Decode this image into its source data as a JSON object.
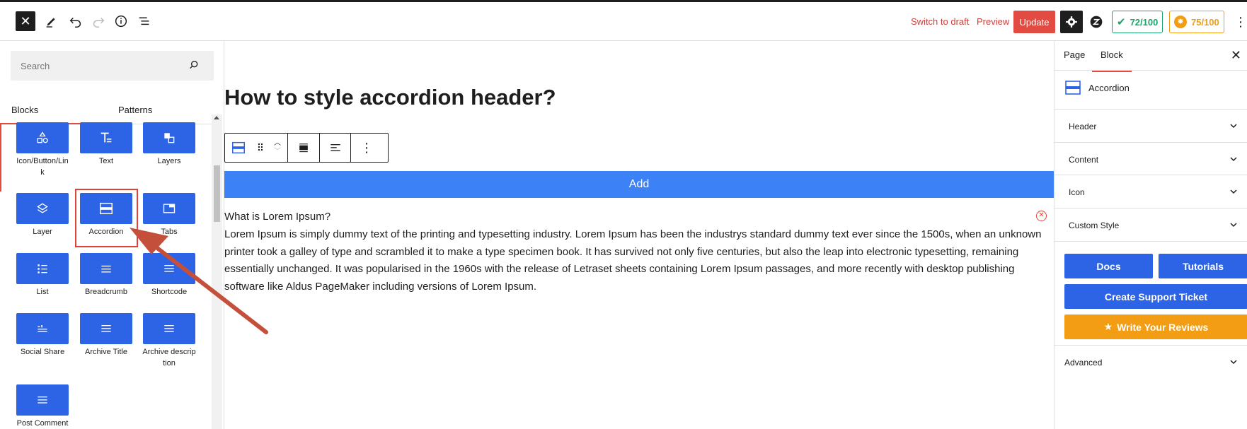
{
  "topbar": {
    "close_icon": "close-icon",
    "switch_to_draft": "Switch to draft",
    "preview": "Preview",
    "update": "Update",
    "score_1": "72/100",
    "score_2": "75/100"
  },
  "left": {
    "search_placeholder": "Search",
    "tab_blocks": "Blocks",
    "tab_patterns": "Patterns",
    "blocks": [
      {
        "label": "Icon/Button/Link",
        "icon": "shapes-icon"
      },
      {
        "label": "Text",
        "icon": "text-icon"
      },
      {
        "label": "Layers",
        "icon": "layers-icon"
      },
      {
        "label": "Layer",
        "icon": "layer-icon"
      },
      {
        "label": "Accordion",
        "icon": "accordion-icon"
      },
      {
        "label": "Tabs",
        "icon": "tabs-icon"
      },
      {
        "label": "List",
        "icon": "list-icon"
      },
      {
        "label": "Breadcrumb",
        "icon": "breadcrumb-icon"
      },
      {
        "label": "Shortcode",
        "icon": "shortcode-icon"
      },
      {
        "label": "Social Share",
        "icon": "social-share-icon"
      },
      {
        "label": "Archive Title",
        "icon": "archive-title-icon"
      },
      {
        "label": "Archive description",
        "icon": "archive-description-icon"
      },
      {
        "label": "Post Comment",
        "icon": "post-comment-icon"
      }
    ]
  },
  "canvas": {
    "title": "How to style accordion header?",
    "add_label": "Add",
    "accordion_title": "What is Lorem Ipsum?",
    "accordion_body": "Lorem Ipsum is simply dummy text of the printing and typesetting industry. Lorem Ipsum has been the industrys standard dummy text ever since the 1500s, when an unknown printer took a galley of type and scrambled it to make a type specimen book. It has survived not only five centuries, but also the leap into electronic typesetting, remaining essentially unchanged. It was popularised in the 1960s with the release of Letraset sheets containing Lorem Ipsum passages, and more recently with desktop publishing software like Aldus PageMaker including versions of Lorem Ipsum."
  },
  "right": {
    "tab_page": "Page",
    "tab_block": "Block",
    "block_name": "Accordion",
    "panels": [
      "Header",
      "Content",
      "Icon",
      "Custom Style"
    ],
    "docs": "Docs",
    "tutorials": "Tutorials",
    "support": "Create Support Ticket",
    "reviews": "Write Your Reviews",
    "advanced": "Advanced"
  },
  "colors": {
    "accent_red": "#e24b41",
    "block_blue": "#2d63e5",
    "add_blue": "#3c82f6",
    "review_orange": "#f29d13",
    "annotation_arrow": "#c4503c"
  }
}
